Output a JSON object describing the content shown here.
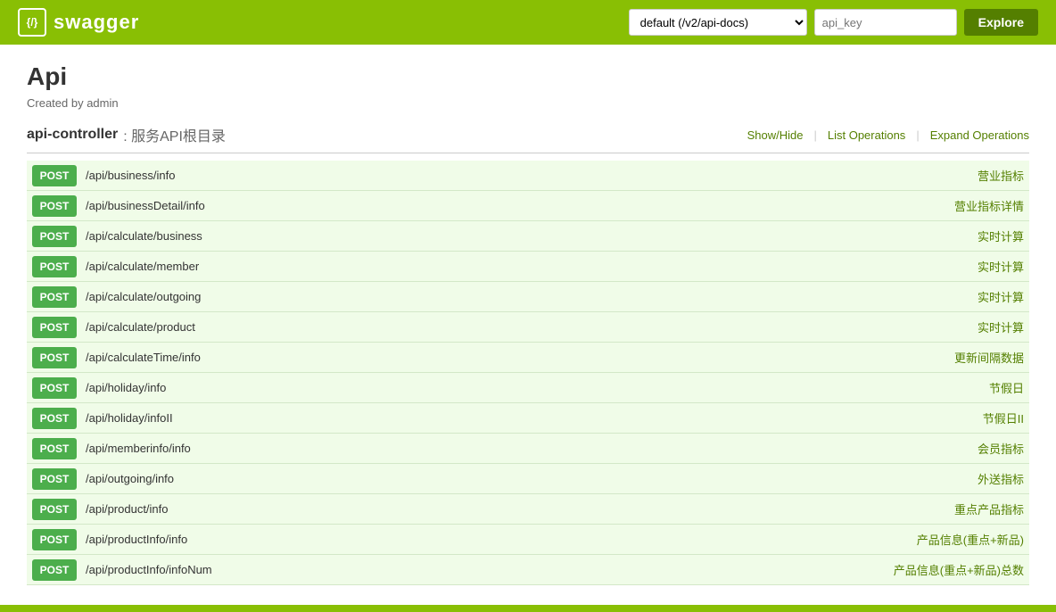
{
  "header": {
    "brand": "swagger",
    "brand_icon": "{/}",
    "url_select": {
      "value": "default (/v2/api-docs)",
      "options": [
        "default (/v2/api-docs)"
      ]
    },
    "api_key_placeholder": "api_key",
    "explore_label": "Explore"
  },
  "page": {
    "title": "Api",
    "created_by": "Created by admin"
  },
  "controller": {
    "name": "api-controller",
    "separator": ":",
    "description": "服务API根目录",
    "actions": {
      "show_hide": "Show/Hide",
      "list_ops": "List Operations",
      "expand_ops": "Expand Operations"
    }
  },
  "api_rows": [
    {
      "method": "POST",
      "path": "/api/business/info",
      "desc": "营业指标"
    },
    {
      "method": "POST",
      "path": "/api/businessDetail/info",
      "desc": "营业指标详情"
    },
    {
      "method": "POST",
      "path": "/api/calculate/business",
      "desc": "实时计算"
    },
    {
      "method": "POST",
      "path": "/api/calculate/member",
      "desc": "实时计算"
    },
    {
      "method": "POST",
      "path": "/api/calculate/outgoing",
      "desc": "实时计算"
    },
    {
      "method": "POST",
      "path": "/api/calculate/product",
      "desc": "实时计算"
    },
    {
      "method": "POST",
      "path": "/api/calculateTime/info",
      "desc": "更新间隔数据"
    },
    {
      "method": "POST",
      "path": "/api/holiday/info",
      "desc": "节假日"
    },
    {
      "method": "POST",
      "path": "/api/holiday/infoII",
      "desc": "节假日II"
    },
    {
      "method": "POST",
      "path": "/api/memberinfo/info",
      "desc": "会员指标"
    },
    {
      "method": "POST",
      "path": "/api/outgoing/info",
      "desc": "外送指标"
    },
    {
      "method": "POST",
      "path": "/api/product/info",
      "desc": "重点产品指标"
    },
    {
      "method": "POST",
      "path": "/api/productInfo/info",
      "desc": "产品信息(重点+新品)"
    },
    {
      "method": "POST",
      "path": "/api/productInfo/infoNum",
      "desc": "产品信息(重点+新品)总数"
    }
  ]
}
